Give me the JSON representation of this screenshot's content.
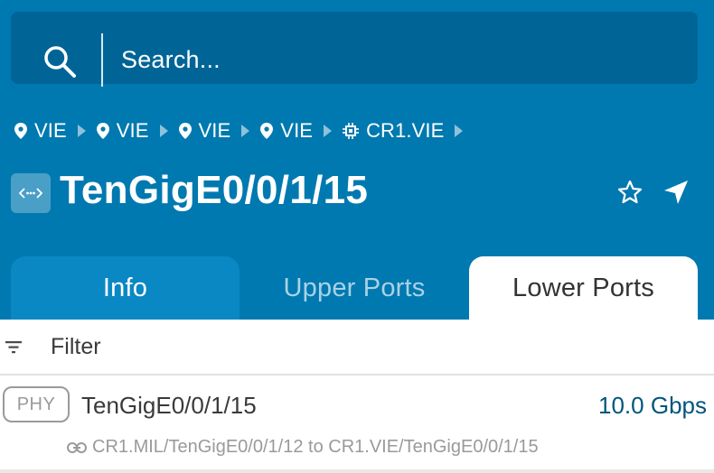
{
  "search": {
    "placeholder": "Search...",
    "icon": "search-icon"
  },
  "breadcrumb": [
    {
      "label": "VIE",
      "icon": "location-pin-icon"
    },
    {
      "label": "VIE",
      "icon": "location-pin-icon"
    },
    {
      "label": "VIE",
      "icon": "location-pin-icon"
    },
    {
      "label": "VIE",
      "icon": "location-pin-icon"
    },
    {
      "label": "CR1.VIE",
      "icon": "chip-icon"
    }
  ],
  "header": {
    "title": "TenGigE0/0/1/15",
    "type_icon": "port-icon",
    "actions": [
      "star-icon",
      "navigate-icon"
    ]
  },
  "tabs": [
    {
      "label": "Info",
      "active": false
    },
    {
      "label": "Upper Ports",
      "active": false
    },
    {
      "label": "Lower Ports",
      "active": true
    }
  ],
  "filter": {
    "label": "Filter",
    "icon": "filter-icon"
  },
  "ports": [
    {
      "tag": "PHY",
      "name": "TenGigE0/0/1/15",
      "speed": "10.0 Gbps",
      "link": "CR1.MIL/TenGigE0/0/1/12 to CR1.VIE/TenGigE0/0/1/15"
    }
  ],
  "colors": {
    "header_bg": "#0079b0",
    "search_bg": "#006596",
    "tab_info_bg": "#0a88c4",
    "speed_text": "#00557d"
  }
}
